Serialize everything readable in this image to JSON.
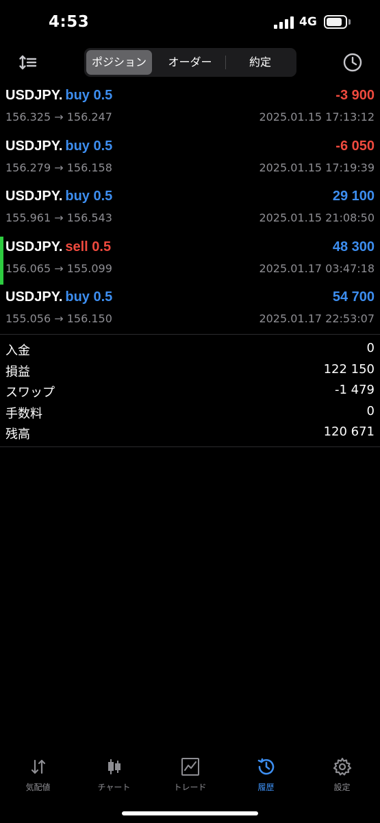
{
  "status_bar": {
    "time": "4:53",
    "network": "4G"
  },
  "toolbar": {
    "sort_icon": "sort-lines-icon",
    "history_icon": "clock-icon",
    "segments": [
      {
        "label": "ポジション",
        "active": true
      },
      {
        "label": "オーダー",
        "active": false
      },
      {
        "label": "約定",
        "active": false
      }
    ]
  },
  "positions": [
    {
      "symbol": "USDJPY.",
      "side": "buy 0.5",
      "side_type": "buy",
      "profit": "-3 900",
      "profit_sign": "neg",
      "prices": "156.325 → 156.247",
      "time": "2025.01.15 17:13:12"
    },
    {
      "symbol": "USDJPY.",
      "side": "buy 0.5",
      "side_type": "buy",
      "profit": "-6 050",
      "profit_sign": "neg",
      "prices": "156.279 → 156.158",
      "time": "2025.01.15 17:19:39"
    },
    {
      "symbol": "USDJPY.",
      "side": "buy 0.5",
      "side_type": "buy",
      "profit": "29 100",
      "profit_sign": "pos",
      "prices": "155.961 → 156.543",
      "time": "2025.01.15 21:08:50"
    },
    {
      "symbol": "USDJPY.",
      "side": "sell 0.5",
      "side_type": "sell",
      "profit": "48 300",
      "profit_sign": "pos",
      "prices": "156.065 → 155.099",
      "time": "2025.01.17 03:47:18",
      "highlight": true
    },
    {
      "symbol": "USDJPY.",
      "side": "buy 0.5",
      "side_type": "buy",
      "profit": "54 700",
      "profit_sign": "pos",
      "prices": "155.056 → 156.150",
      "time": "2025.01.17 22:53:07"
    }
  ],
  "summary": [
    {
      "label": "入金",
      "value": "0"
    },
    {
      "label": "損益",
      "value": "122 150"
    },
    {
      "label": "スワップ",
      "value": "-1 479"
    },
    {
      "label": "手数料",
      "value": "0"
    },
    {
      "label": "残高",
      "value": "120 671"
    }
  ],
  "tabbar": [
    {
      "label": "気配値",
      "icon": "quotes-arrows-icon",
      "active": false
    },
    {
      "label": "チャート",
      "icon": "candlestick-chart-icon",
      "active": false
    },
    {
      "label": "トレード",
      "icon": "trade-line-chart-icon",
      "active": false
    },
    {
      "label": "履歴",
      "icon": "history-icon",
      "active": true
    },
    {
      "label": "設定",
      "icon": "gear-icon",
      "active": false
    }
  ],
  "colors": {
    "buy": "#3d8ef0",
    "sell": "#ef4a3e",
    "highlight_marker": "#2ecc40",
    "muted_text": "#8e8e93"
  }
}
